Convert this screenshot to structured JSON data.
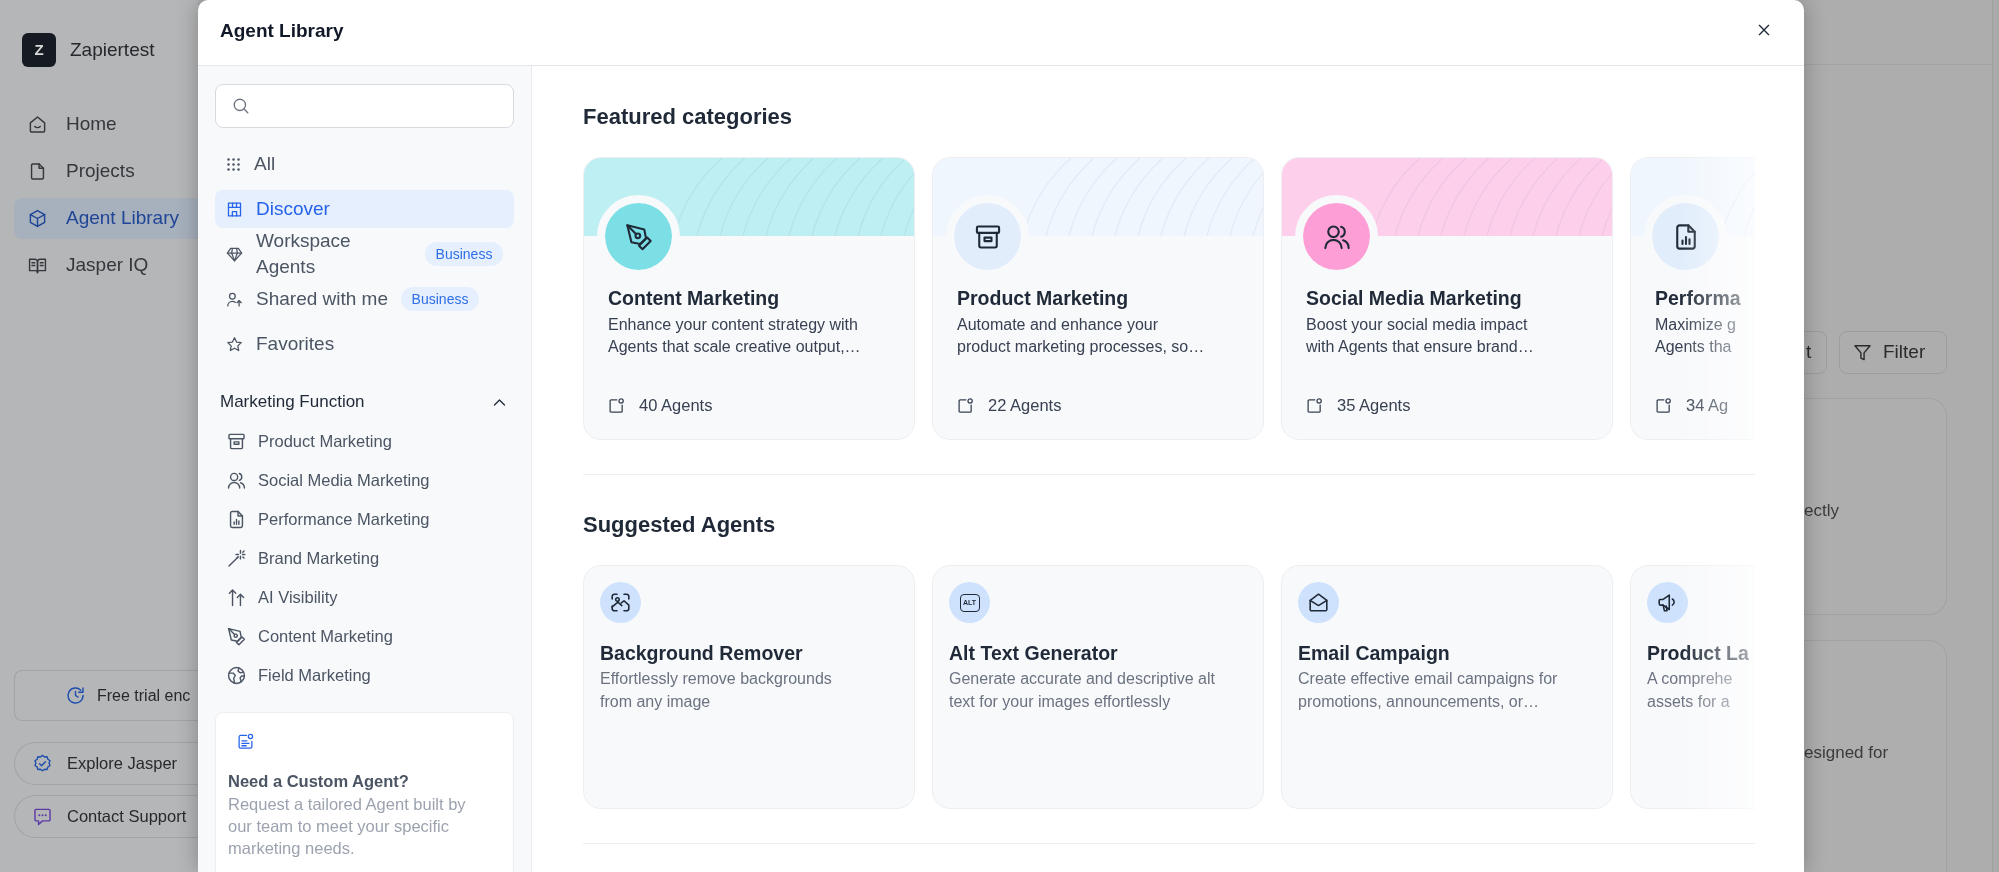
{
  "sidebar": {
    "workspace": {
      "initial": "Z",
      "name": "Zapiertest"
    },
    "items": [
      {
        "label": "Home",
        "selected": false
      },
      {
        "label": "Projects",
        "selected": false
      },
      {
        "label": "Agent Library",
        "selected": true
      },
      {
        "label": "Jasper IQ",
        "selected": false
      }
    ],
    "footer": [
      {
        "kind": "box",
        "label": "Free trial enc"
      },
      {
        "kind": "pill",
        "label": "Explore Jasper"
      },
      {
        "kind": "pill",
        "label": "Contact Support"
      }
    ]
  },
  "modal": {
    "title": "Agent Library",
    "nav": [
      {
        "label": "All",
        "selected": false
      },
      {
        "label": "Discover",
        "selected": true
      },
      {
        "label": "Workspace Agents",
        "selected": false,
        "badge": "Business"
      },
      {
        "label": "Shared with me",
        "selected": false,
        "badge": "Business"
      },
      {
        "label": "Favorites",
        "selected": false
      }
    ],
    "section": {
      "title": "Marketing Function",
      "expanded": true,
      "items": [
        {
          "label": "Product Marketing",
          "selected": false
        },
        {
          "label": "Social Media Marketing",
          "selected": false
        },
        {
          "label": "Performance Marketing",
          "selected": false
        },
        {
          "label": "Brand Marketing",
          "selected": false
        },
        {
          "label": "AI Visibility",
          "selected": false
        },
        {
          "label": "Content Marketing",
          "selected": false
        },
        {
          "label": "Field Marketing",
          "selected": false
        }
      ]
    },
    "promo": {
      "title": "Need a Custom Agent?",
      "text": "Request a tailored Agent built by our team to meet your specific marketing needs."
    },
    "featured": {
      "title": "Featured categories",
      "cards": [
        {
          "kind": "full",
          "title": "Content Marketing",
          "description": [
            "Enhance your content strategy with",
            "Agents that scale creative output,…"
          ],
          "count": "40 Agents",
          "color": "#7ddfe6"
        },
        {
          "kind": "full",
          "title": "Product Marketing",
          "description": [
            "Automate and enhance your",
            "product marketing processes, so…"
          ],
          "count": "22 Agents",
          "color": "#e1edfb"
        },
        {
          "kind": "full",
          "title": "Social Media Marketing",
          "description": [
            "Boost your social media impact",
            "with Agents that ensure brand…"
          ],
          "count": "35 Agents",
          "color": "#fd9fd6"
        },
        {
          "kind": "clipped",
          "title": "Performa",
          "description": [
            "Maximize g",
            "Agents tha"
          ],
          "count": "34 Ag",
          "color": "#e1edfb"
        }
      ]
    },
    "suggested": {
      "title": "Suggested Agents",
      "cards": [
        {
          "kind": "full",
          "title": "Background Remover",
          "description": [
            "Effortlessly remove backgrounds",
            "from any image"
          ]
        },
        {
          "kind": "full",
          "title": "Alt Text Generator",
          "description": [
            "Generate accurate and descriptive alt",
            "text for your images effortlessly"
          ],
          "icon_text": "ALT"
        },
        {
          "kind": "full",
          "title": "Email Campaign",
          "description": [
            "Create effective email campaigns for",
            "promotions, announcements, or…"
          ]
        },
        {
          "kind": "clipped",
          "title": "Product La",
          "description": [
            "A comprehe",
            "assets for a"
          ]
        }
      ]
    }
  },
  "main": {
    "toolbar": [
      {
        "kind": "clipped",
        "label": "t"
      },
      {
        "kind": "full",
        "label": "Filter"
      }
    ],
    "cards": [
      {
        "text": "ectly"
      },
      {
        "text": "esigned for"
      }
    ]
  }
}
